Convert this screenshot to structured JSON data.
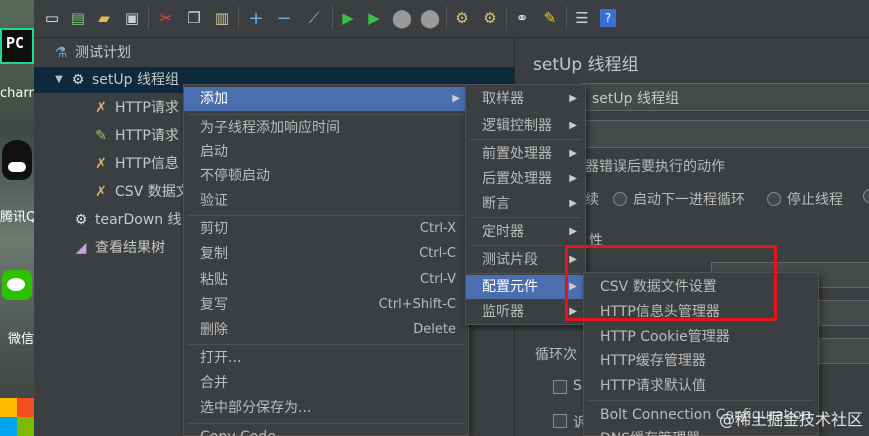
{
  "desktop": {
    "pycharm_label": "charm",
    "pycharm_logo_text": "PC",
    "qq_label": "腾讯Q",
    "wechat_label": "微信"
  },
  "toolbar": {
    "icons": [
      "new-icon",
      "templates-icon",
      "open-icon",
      "save-icon",
      "cut-icon",
      "copy-icon",
      "paste-icon",
      "expand-icon",
      "collapse-icon",
      "toggle-icon",
      "start-icon",
      "start-no-pause-icon",
      "stop-icon",
      "shutdown-icon",
      "clear-icon",
      "clear-all-icon",
      "search-icon",
      "reset-search-icon",
      "function-helper-icon",
      "help-icon"
    ]
  },
  "tree": {
    "items": [
      {
        "label": "测试计划"
      },
      {
        "label": "setUp 线程组"
      },
      {
        "label": "HTTP请求"
      },
      {
        "label": "HTTP请求"
      },
      {
        "label": "HTTP信息"
      },
      {
        "label": "CSV 数据文"
      },
      {
        "label": "tearDown 线"
      },
      {
        "label": "查看结果树"
      }
    ]
  },
  "right_panel": {
    "title": "setUp 线程组",
    "name_value": "setUp 线程组",
    "error_action_label": "器错误后要执行的动作",
    "radio_continue": "续",
    "radio_next_loop": "启动下一进程循环",
    "radio_stop_thread": "停止线程",
    "thread_props_label": "性",
    "loop_label": "循环次",
    "checkbox_s": "Sa",
    "checkbox_t": "诉"
  },
  "context_menu": {
    "items": [
      {
        "label": "添加",
        "accel": "",
        "submenu": true
      },
      {
        "label": "为子线程添加响应时间",
        "accel": ""
      },
      {
        "label": "启动",
        "accel": ""
      },
      {
        "label": "不停顿启动",
        "accel": ""
      },
      {
        "label": "验证",
        "accel": ""
      },
      {
        "label": "剪切",
        "accel": "Ctrl-X"
      },
      {
        "label": "复制",
        "accel": "Ctrl-C"
      },
      {
        "label": "粘贴",
        "accel": "Ctrl-V"
      },
      {
        "label": "复写",
        "accel": "Ctrl+Shift-C"
      },
      {
        "label": "删除",
        "accel": "Delete"
      },
      {
        "label": "打开...",
        "accel": ""
      },
      {
        "label": "合并",
        "accel": ""
      },
      {
        "label": "选中部分保存为...",
        "accel": ""
      },
      {
        "label": "Copy Code",
        "accel": ""
      }
    ]
  },
  "add_submenu": {
    "items": [
      {
        "label": "取样器"
      },
      {
        "label": "逻辑控制器"
      },
      {
        "label": "前置处理器"
      },
      {
        "label": "后置处理器"
      },
      {
        "label": "断言"
      },
      {
        "label": "定时器"
      },
      {
        "label": "测试片段"
      },
      {
        "label": "配置元件"
      },
      {
        "label": "监听器"
      }
    ]
  },
  "config_submenu": {
    "items": [
      {
        "label": "CSV 数据文件设置"
      },
      {
        "label": "HTTP信息头管理器"
      },
      {
        "label": "HTTP Cookie管理器"
      },
      {
        "label": "HTTP缓存管理器"
      },
      {
        "label": "HTTP请求默认值"
      },
      {
        "label": "Bolt Connection Configuration"
      },
      {
        "label": "DNS缓存管理器"
      }
    ]
  },
  "watermark": "@稀土掘金技术社区",
  "colors": {
    "selection": "#4b6eaf",
    "highlight_box": "#e2141f",
    "background": "#3c3f41"
  }
}
